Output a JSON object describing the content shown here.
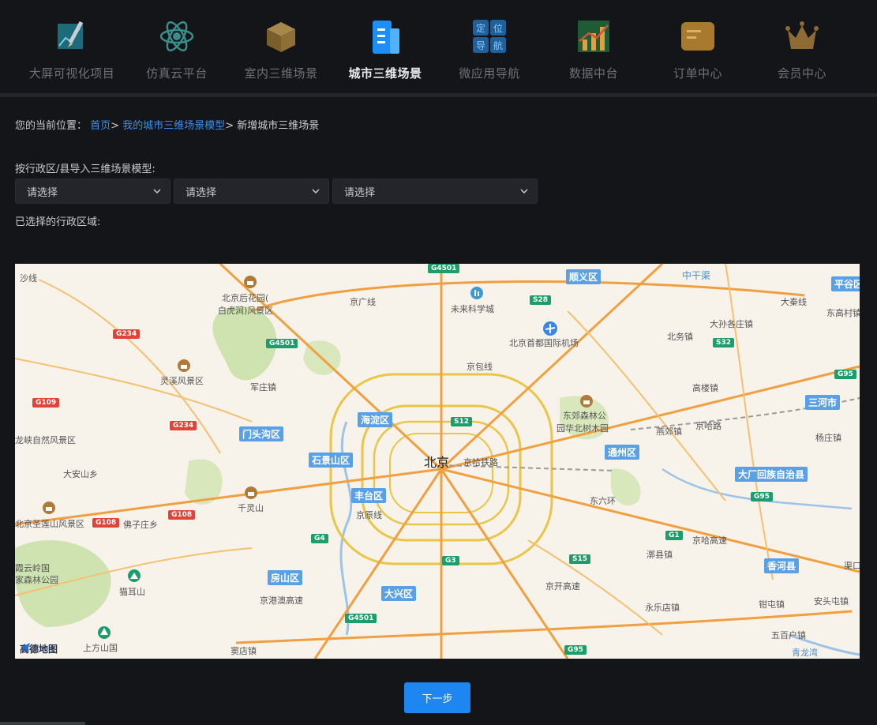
{
  "nav": {
    "items": [
      {
        "label": "大屏可视化项目",
        "icon": "chart-pencil-icon",
        "active": false
      },
      {
        "label": "仿真云平台",
        "icon": "atom-icon",
        "active": false
      },
      {
        "label": "室内三维场景",
        "icon": "cube-icon",
        "active": false
      },
      {
        "label": "城市三维场景",
        "icon": "building-icon",
        "active": true
      },
      {
        "label": "微应用导航",
        "icon": "grid-nav-icon",
        "active": false
      },
      {
        "label": "数据中台",
        "icon": "bar-chart-icon",
        "active": false
      },
      {
        "label": "订单中心",
        "icon": "order-card-icon",
        "active": false
      },
      {
        "label": "会员中心",
        "icon": "crown-icon",
        "active": false
      }
    ],
    "nav_icon_text": {
      "t1": "定",
      "t2": "位",
      "t3": "导",
      "t4": "航"
    }
  },
  "breadcrumb": {
    "prefix": "您的当前位置：",
    "home": "首页",
    "sep": ">",
    "models": "我的城市三维场景模型",
    "current": "新增城市三维场景"
  },
  "form": {
    "import_label": "按行政区/县导入三维场景模型:",
    "selects": [
      {
        "value": "请选择"
      },
      {
        "value": "请选择"
      },
      {
        "value": "请选择"
      }
    ],
    "chosen_label": "已选择的行政区域:"
  },
  "map": {
    "center_label": "北京",
    "districts": [
      "顺义区",
      "平谷区",
      "海淀区",
      "门头沟区",
      "石景山区",
      "丰台区",
      "通州区",
      "三河市",
      "大厂回族自治县",
      "房山区",
      "大兴区",
      "香河县"
    ],
    "places": [
      "北京后花园(",
      "白虎涧)风景区",
      "未来科学城",
      "北京首都国际机场",
      "灵溪风景区",
      "军庄镇",
      "东郊森林公",
      "园华北树木园",
      "千灵山",
      "大安山乡",
      "北京圣莲山风景区",
      "佛子庄乡",
      "猫耳山",
      "上方山国",
      "家森林公园",
      "霞云岭国",
      "家森林公园",
      "龙峡自然风景区",
      "北务镇",
      "大孙各庄镇",
      "东高村镇",
      "高楼镇",
      "燕郊镇",
      "杨庄镇",
      "漷县镇",
      "永乐店镇",
      "钳屯镇",
      "安头屯镇",
      "五百户镇",
      "窦店镇",
      "中干渠",
      "京哈高速",
      "京哈铁路",
      "东六环",
      "京哈路",
      "京包线",
      "京原线",
      "京港澳高速",
      "京开高速",
      "京广线",
      "大秦线",
      "沙线",
      "京包线",
      "渠口",
      "青龙湾"
    ],
    "shields": [
      {
        "text": "G4501",
        "color": "green"
      },
      {
        "text": "S28",
        "color": "green"
      },
      {
        "text": "G234",
        "color": "red"
      },
      {
        "text": "G4501",
        "color": "green"
      },
      {
        "text": "S32",
        "color": "green"
      },
      {
        "text": "G95",
        "color": "green"
      },
      {
        "text": "G109",
        "color": "red"
      },
      {
        "text": "G234",
        "color": "red"
      },
      {
        "text": "S12",
        "color": "green"
      },
      {
        "text": "G95",
        "color": "green"
      },
      {
        "text": "G108",
        "color": "red"
      },
      {
        "text": "G108",
        "color": "red"
      },
      {
        "text": "G4",
        "color": "green"
      },
      {
        "text": "G1",
        "color": "green"
      },
      {
        "text": "G3",
        "color": "green"
      },
      {
        "text": "S15",
        "color": "green"
      },
      {
        "text": "G4501",
        "color": "green"
      },
      {
        "text": "G95",
        "color": "green"
      }
    ],
    "attribution": "高德地图"
  },
  "actions": {
    "next": "下一步"
  }
}
